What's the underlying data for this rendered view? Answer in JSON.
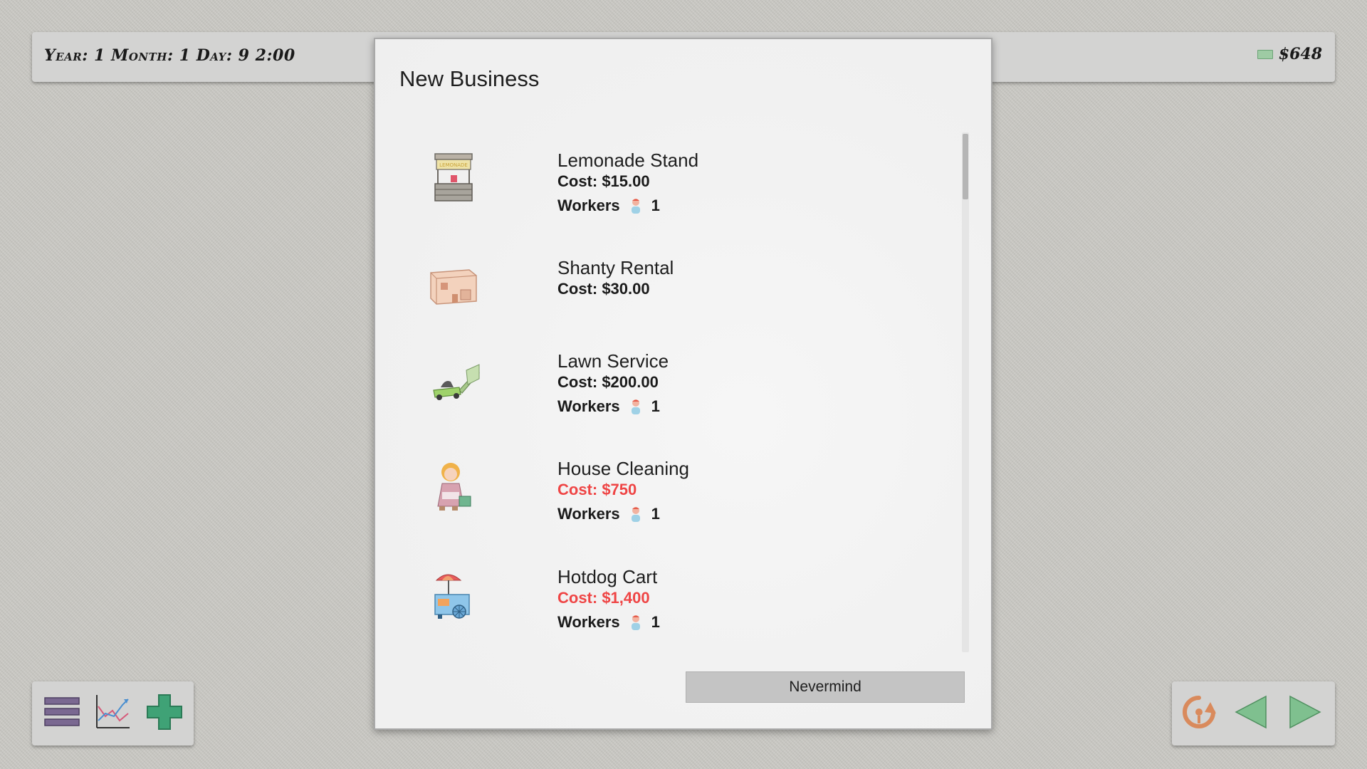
{
  "header": {
    "date_text": "Year: 1 Month: 1 Day: 9 2:00",
    "money": "$648",
    "money_icon": "cash-icon"
  },
  "dialog": {
    "title": "New Business",
    "businesses": [
      {
        "name": "Lemonade Stand",
        "cost": "Cost: $15.00",
        "affordable": true,
        "has_workers": true,
        "workers_label": "Workers",
        "workers_count": "1",
        "icon": "lemonade-stand-icon"
      },
      {
        "name": "Shanty Rental",
        "cost": "Cost: $30.00",
        "affordable": true,
        "has_workers": false,
        "icon": "shanty-icon"
      },
      {
        "name": "Lawn Service",
        "cost": "Cost: $200.00",
        "affordable": true,
        "has_workers": true,
        "workers_label": "Workers",
        "workers_count": "1",
        "icon": "lawn-mower-icon"
      },
      {
        "name": "House Cleaning",
        "cost": "Cost: $750",
        "affordable": false,
        "has_workers": true,
        "workers_label": "Workers",
        "workers_count": "1",
        "icon": "house-cleaner-icon"
      },
      {
        "name": "Hotdog Cart",
        "cost": "Cost: $1,400",
        "affordable": false,
        "has_workers": true,
        "workers_label": "Workers",
        "workers_count": "1",
        "icon": "hotdog-cart-icon"
      }
    ],
    "nevermind_label": "Nevermind"
  },
  "toolbar_left": [
    "menu-icon",
    "stats-chart-icon",
    "add-business-icon"
  ],
  "toolbar_right": [
    "restart-icon",
    "previous-icon",
    "next-icon"
  ],
  "colors": {
    "unaffordable": "#ef4545",
    "menu": "#7a6891",
    "add": "#3fa276",
    "nav": "#7fc08f",
    "restart": "#d98a5c"
  }
}
